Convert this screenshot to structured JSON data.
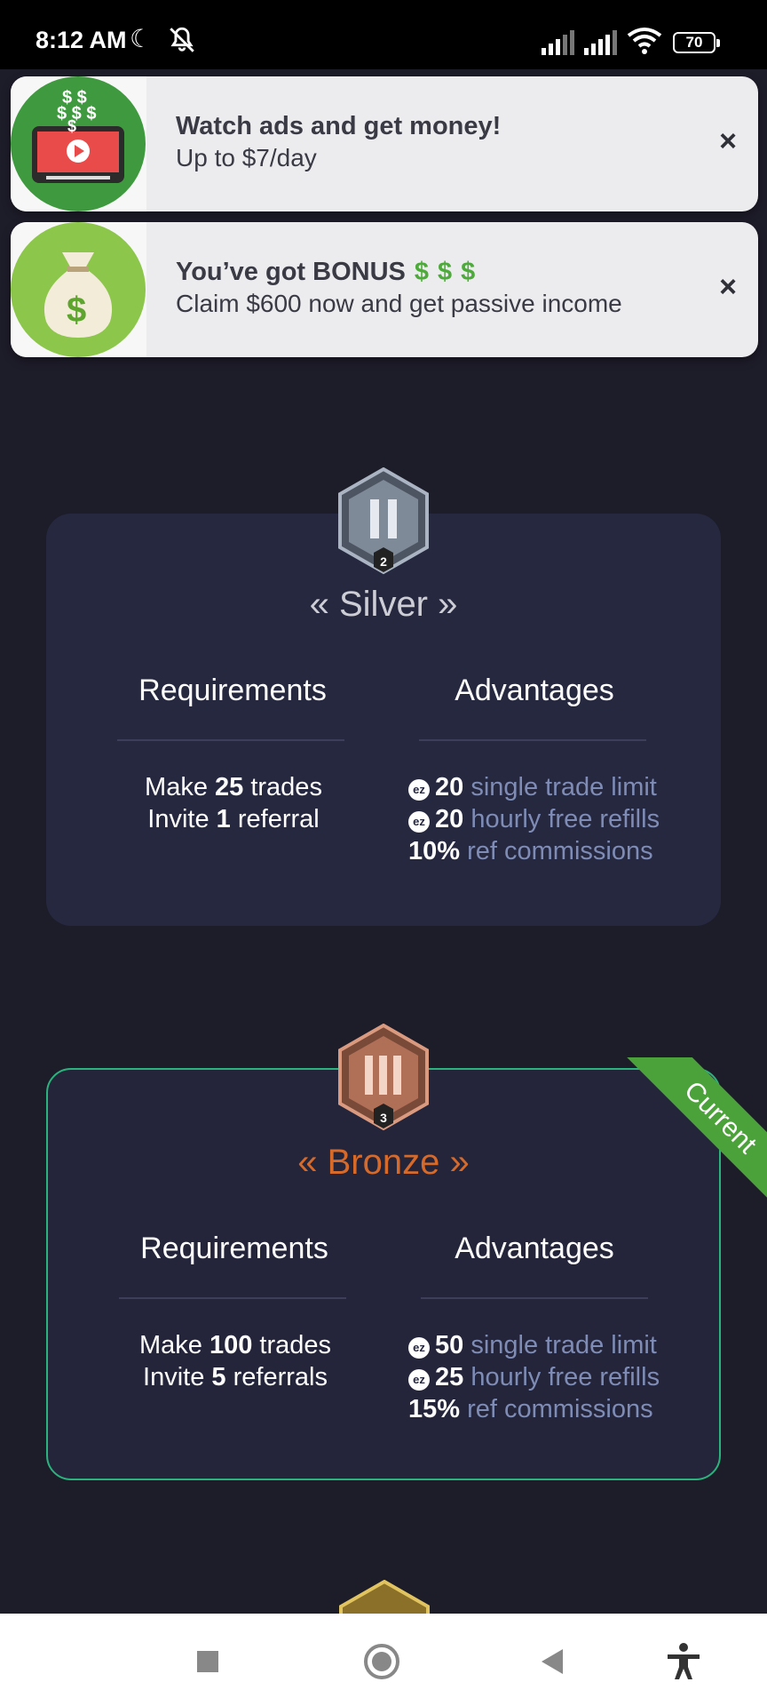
{
  "status_bar": {
    "time": "8:12 AM",
    "battery": "70"
  },
  "notifications": [
    {
      "title": "Watch ads and get money!",
      "subtitle": "Up to $7/day",
      "close": "×"
    },
    {
      "title": "You’ve got BONUS",
      "dollars": "$$$",
      "subtitle": "Claim $600 now and get passive income",
      "close": "×"
    }
  ],
  "tiers": [
    {
      "roman": "II",
      "level": "2",
      "name": "« Silver »",
      "requirements_label": "Requirements",
      "advantages_label": "Advantages",
      "requirements": [
        {
          "pre": "Make ",
          "num": "25",
          "post": " trades"
        },
        {
          "pre": "Invite ",
          "num": "1",
          "post": " referral"
        }
      ],
      "advantages": [
        {
          "coin": true,
          "num": "20",
          "label": " single trade limit"
        },
        {
          "coin": true,
          "num": "20",
          "label": " hourly free refills"
        },
        {
          "coin": false,
          "num": "10%",
          "label": " ref commissions"
        }
      ]
    },
    {
      "roman": "III",
      "level": "3",
      "name": "« Bronze »",
      "ribbon": "Current",
      "requirements_label": "Requirements",
      "advantages_label": "Advantages",
      "requirements": [
        {
          "pre": "Make ",
          "num": "100",
          "post": " trades"
        },
        {
          "pre": "Invite ",
          "num": "5",
          "post": " referrals"
        }
      ],
      "advantages": [
        {
          "coin": true,
          "num": "50",
          "label": " single trade limit"
        },
        {
          "coin": true,
          "num": "25",
          "label": " hourly free refills"
        },
        {
          "coin": false,
          "num": "15%",
          "label": " ref commissions"
        }
      ]
    }
  ],
  "coin_symbol": "ez",
  "colors": {
    "background": "#1d1c29",
    "card": "#262840",
    "accent_green": "#2bb37d",
    "bronze": "#d66a2a",
    "muted_label": "#7e8cb6"
  },
  "icons": {
    "nav": [
      "recents-square-icon",
      "home-circle-icon",
      "back-triangle-icon",
      "accessibility-icon"
    ]
  }
}
